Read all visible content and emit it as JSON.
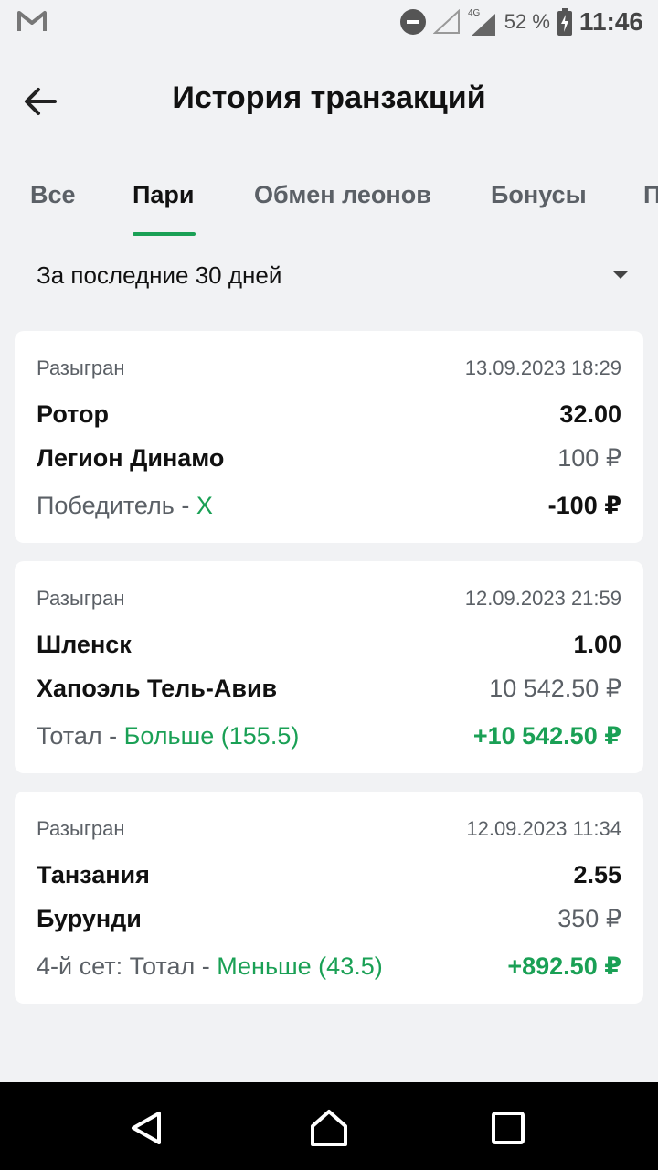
{
  "status_bar": {
    "network": "4G",
    "battery": "52 %",
    "time": "11:46",
    "icons": [
      "gmail-icon",
      "do-not-disturb-icon",
      "wifi-off-icon",
      "signal-icon",
      "battery-charging-icon"
    ]
  },
  "header": {
    "title": "История транзакций",
    "back_icon": "back-arrow-icon"
  },
  "tabs": [
    {
      "label": "Все",
      "active": false
    },
    {
      "label": "Пари",
      "active": true
    },
    {
      "label": "Обмен леонов",
      "active": false
    },
    {
      "label": "Бонусы",
      "active": false
    },
    {
      "label": "П",
      "active": false
    }
  ],
  "filter": {
    "period": "За последние 30 дней",
    "icon": "dropdown-caret-icon"
  },
  "bets": [
    {
      "status": "Разыгран",
      "datetime": "13.09.2023 18:29",
      "team1": "Ротор",
      "odds": "32.00",
      "team2": "Легион Динамо",
      "stake": "100 ₽",
      "market": "Победитель - ",
      "pick": "Х",
      "result": "-100 ₽",
      "result_color": "#111111"
    },
    {
      "status": "Разыгран",
      "datetime": "12.09.2023 21:59",
      "team1": "Шленск",
      "odds": "1.00",
      "team2": "Хапоэль Тель-Авив",
      "stake": "10 542.50 ₽",
      "market": "Тотал - ",
      "pick": "Больше (155.5)",
      "result": "+10 542.50 ₽",
      "result_color": "#1aa055"
    },
    {
      "status": "Разыгран",
      "datetime": "12.09.2023 11:34",
      "team1": "Танзания",
      "odds": "2.55",
      "team2": "Бурунди",
      "stake": "350 ₽",
      "market": "4-й сет: Тотал - ",
      "pick": "Меньше (43.5)",
      "result": "+892.50 ₽",
      "result_color": "#1aa055"
    }
  ],
  "nav_bar": {
    "icons": [
      "back-triangle-icon",
      "home-icon",
      "recents-square-icon"
    ]
  },
  "colors": {
    "accent": "#1aa055",
    "background": "#f1f2f4",
    "card": "#ffffff",
    "muted_text": "#5b6066"
  }
}
